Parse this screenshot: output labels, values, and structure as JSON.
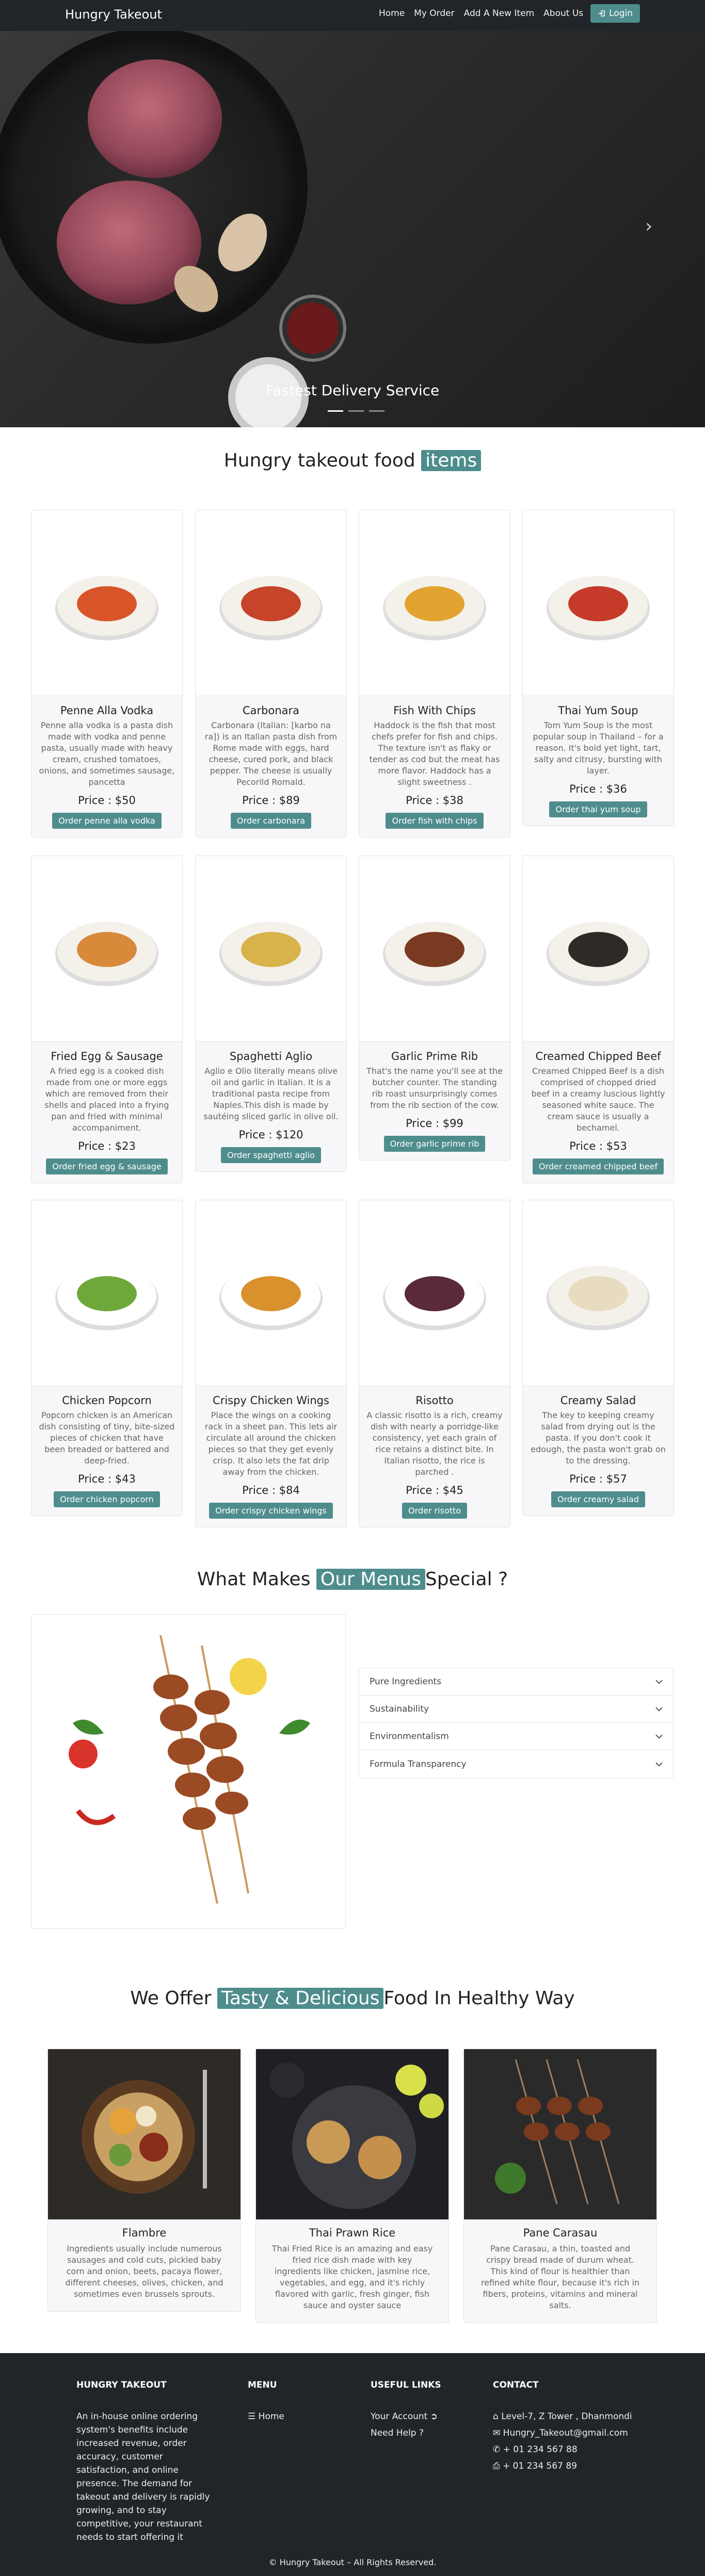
{
  "nav": {
    "brand": "Hungry Takeout",
    "links": [
      "Home",
      "My Order",
      "Add A New Item",
      "About Us"
    ],
    "login": "Login"
  },
  "hero": {
    "caption": "Fastest Delivery Service"
  },
  "menu_section": {
    "title_pre": "Hungry takeout food",
    "title_hl": "items"
  },
  "items": [
    {
      "name": "Penne Alla Vodka",
      "desc": "Penne alla vodka is a pasta dish made with vodka and penne pasta, usually made with heavy cream, crushed tomatoes, onions, and sometimes sausage, pancetta",
      "price": "Price : $50",
      "btn": "Order penne alla vodka"
    },
    {
      "name": "Carbonara",
      "desc": "Carbonara (Italian: [karbo na ra]) is an Italian pasta dish from Rome made with eggs, hard cheese, cured pork, and black pepper. The cheese is usually Pecorild Romald.",
      "price": "Price : $89",
      "btn": "Order carbonara"
    },
    {
      "name": "Fish With Chips",
      "desc": "Haddock is the fish that most chefs prefer for fish and chips. The texture isn't as flaky or tender as cod but the meat has more flavor. Haddock has a slight sweetness .",
      "price": "Price : $38",
      "btn": "Order fish with chips"
    },
    {
      "name": "Thai Yum Soup",
      "desc": "Tom Yum Soup is the most popular soup in Thailand – for a reason. It's bold yet light, tart, salty and citrusy, bursting with layer.",
      "price": "Price : $36",
      "btn": "Order thai yum soup"
    },
    {
      "name": "Fried Egg & Sausage",
      "desc": "A fried egg is a cooked dish made from one or more eggs which are removed from their shells and placed into a frying pan and fried with minimal accompaniment.",
      "price": "Price : $23",
      "btn": "Order fried egg & sausage"
    },
    {
      "name": "Spaghetti Aglio",
      "desc": "Aglio e Olio literally means olive oil and garlic in Italian. It is a traditional pasta recipe from Naples.This dish is made by sautéing sliced garlic in olive oil.",
      "price": "Price : $120",
      "btn": "Order spaghetti aglio"
    },
    {
      "name": "Garlic Prime Rib",
      "desc": "That's the name you'll see at the butcher counter. The standing rib roast unsurprisingly comes from the rib section of the cow.",
      "price": "Price : $99",
      "btn": "Order garlic prime rib"
    },
    {
      "name": "Creamed Chipped Beef",
      "desc": "Creamed Chipped Beef is a dish comprised of chopped dried beef in a creamy luscious lightly seasoned white sauce. The cream sauce is usually a bechamel.",
      "price": "Price : $53",
      "btn": "Order creamed chipped beef"
    },
    {
      "name": "Chicken Popcorn",
      "desc": "Popcorn chicken is an American dish consisting of tiny, bite-sized pieces of chicken that have been breaded or battered and deep-fried.",
      "price": "Price : $43",
      "btn": "Order chicken popcorn"
    },
    {
      "name": "Crispy Chicken Wings",
      "desc": "Place the wings on a cooking rack in a sheet pan. This lets air circulate all around the chicken pieces so that they get evenly crisp. It also lets the fat drip away from the chicken.",
      "price": "Price : $84",
      "btn": "Order crispy chicken wings"
    },
    {
      "name": "Risotto",
      "desc": "A classic risotto is a rich, creamy dish with nearly a porridge-like consistency, yet each grain of rice retains a distinct bite. In Italian risotto, the rice is parched .",
      "price": "Price : $45",
      "btn": "Order risotto"
    },
    {
      "name": "Creamy Salad",
      "desc": "The key to keeping creamy salad from drying out is the pasta. If you don't cook it edough, the pasta won't grab on to the dressing.",
      "price": "Price : $57",
      "btn": "Order creamy salad"
    }
  ],
  "special": {
    "title_pre": "What Makes",
    "title_hl": "Our Menus",
    "title_post": "Special ?",
    "accordion": [
      "Pure Ingredients",
      "Sustainability",
      "Environmentalism",
      "Formula Transparency"
    ]
  },
  "offer": {
    "title_pre": "We Offer",
    "title_hl": "Tasty & Delicious",
    "title_post": "Food In Healthy Way",
    "cards": [
      {
        "name": "Flambre",
        "desc": "Ingredients usually include numerous sausages and cold cuts, pickled baby corn and onion, beets, pacaya flower, different cheeses, olives, chicken, and sometimes even brussels sprouts."
      },
      {
        "name": "Thai Prawn Rice",
        "desc": "Thai Fried Rice is an amazing and easy fried rice dish made with key ingredients like chicken, jasmine rice, vegetables, and egg, and it's richly flavored with garlic, fresh ginger, fish sauce and oyster sauce"
      },
      {
        "name": "Pane Carasau",
        "desc": "Pane Carasau, a thin, toasted and crispy bread made of durum wheat. This kind of flour is healthier than refined white flour, because it's rich in fibers, proteins, vitamins and mineral salts."
      }
    ]
  },
  "footer": {
    "about_title": "HUNGRY TAKEOUT",
    "about_text": "An in-house online ordering system's benefits include increased revenue, order accuracy, customer satisfaction, and online presence. The demand for takeout and delivery is rapidly growing, and to stay competitive, your restaurant needs to start offering it",
    "menu_title": "MENU",
    "menu_home": "Home",
    "links_title": "USEFUL LINKS",
    "link_account": "Your Account",
    "link_help": "Need Help",
    "contact_title": "CONTACT",
    "address": "Level-7, Z Tower , Dhanmondi",
    "email": "Hungry_Takeout@gmail.com",
    "phone": "+ 01 234 567 88",
    "fax": "+ 01 234 567 89",
    "copyright": "© Hungry Takeout – All Rights Reserved."
  },
  "colors": {
    "accent": "#4f8d8d",
    "dark": "#212529"
  }
}
